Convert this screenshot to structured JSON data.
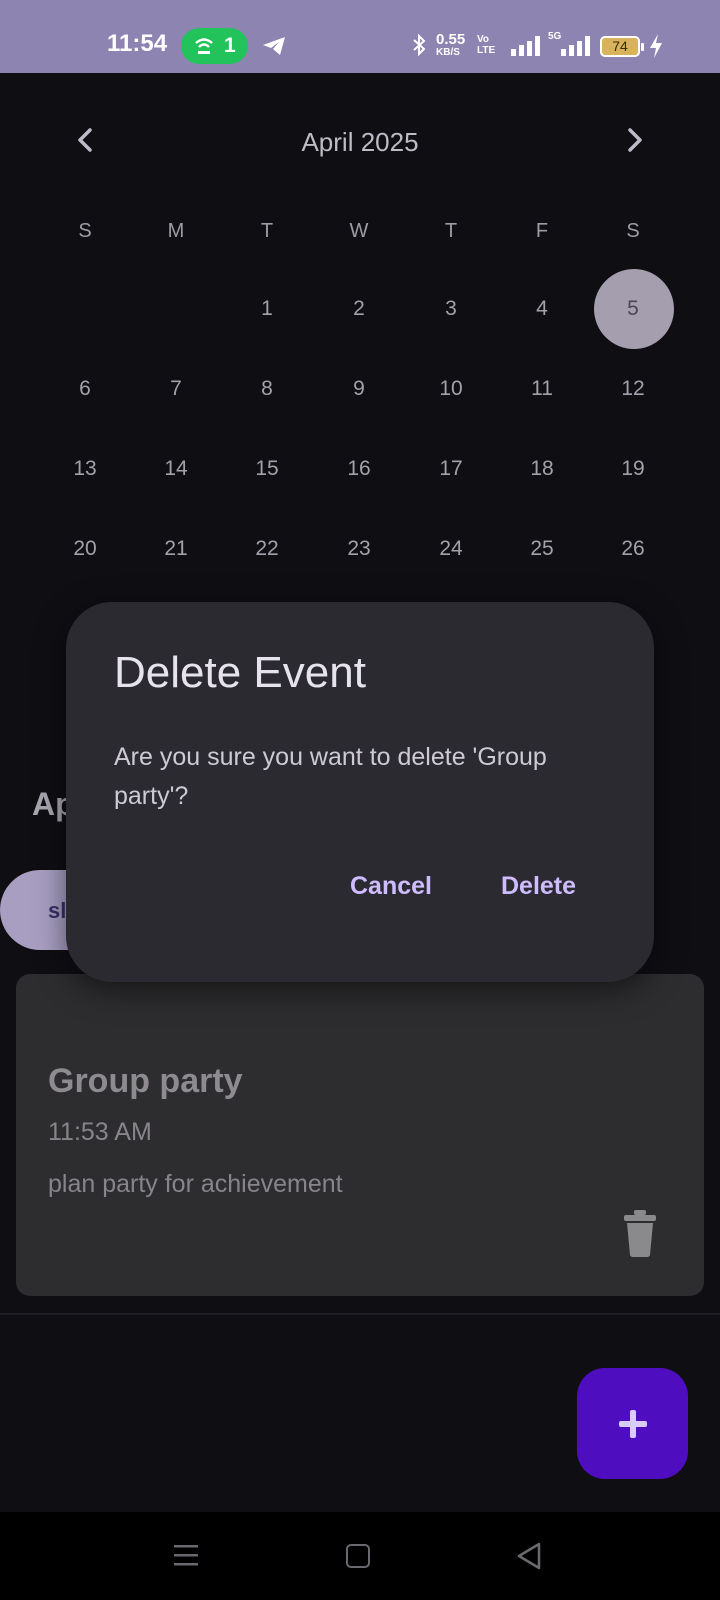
{
  "status_bar": {
    "time": "11:54",
    "hotspot_count": "1",
    "net_speed_value": "0.55",
    "net_speed_unit": "KB/S",
    "volte_top": "Vo",
    "volte_bottom": "LTE",
    "network_type": "5G",
    "battery": "74",
    "accent_color": "#8e84b2"
  },
  "calendar": {
    "month_title": "April 2025",
    "weekdays": [
      "S",
      "M",
      "T",
      "W",
      "T",
      "F",
      "S"
    ],
    "selected_day": "5",
    "rows": [
      [
        "",
        "",
        "1",
        "2",
        "3",
        "4",
        "5"
      ],
      [
        "6",
        "7",
        "8",
        "9",
        "10",
        "11",
        "12"
      ],
      [
        "13",
        "14",
        "15",
        "16",
        "17",
        "18",
        "19"
      ],
      [
        "20",
        "21",
        "22",
        "23",
        "24",
        "25",
        "26"
      ]
    ]
  },
  "background": {
    "section_title_partial": "Ap",
    "chip_partial": "sl"
  },
  "event": {
    "title": "Group party",
    "time": "11:53 AM",
    "description": "plan party for achievement"
  },
  "dialog": {
    "title": "Delete Event",
    "message": "Are you sure you want to delete 'Group party'?",
    "cancel_label": "Cancel",
    "delete_label": "Delete"
  },
  "fab": {
    "icon": "plus-icon",
    "color": "#4e0ebf"
  }
}
